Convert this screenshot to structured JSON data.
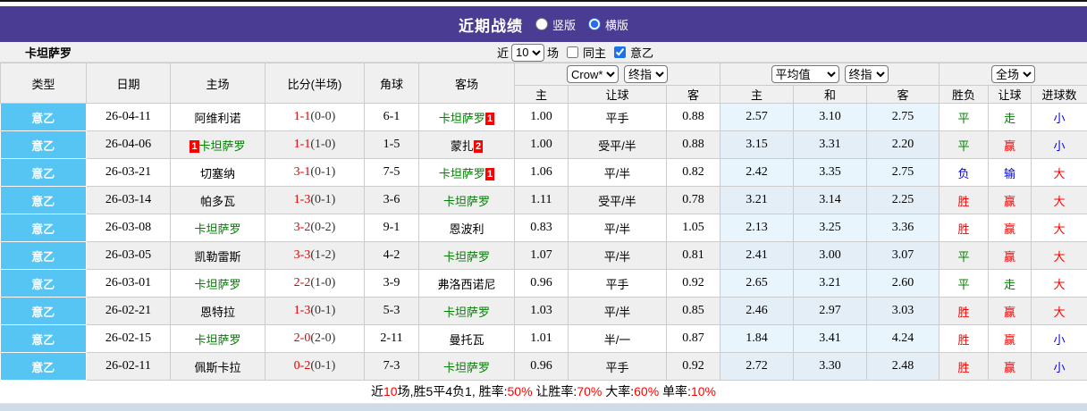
{
  "topbar": {
    "title": "近期战绩",
    "radios": [
      {
        "label": "竖版",
        "checked": false
      },
      {
        "label": "横版",
        "checked": true
      }
    ]
  },
  "controls": {
    "team": "卡坦萨罗",
    "near_label": "近",
    "match_count": "10",
    "field_label": "场",
    "same_home_label": "同主",
    "same_home_checked": false,
    "league_filter_label": "意乙",
    "league_filter_checked": true
  },
  "table": {
    "headers": {
      "type": "类型",
      "date": "日期",
      "home": "主场",
      "score": "比分(半场)",
      "corner": "角球",
      "away": "客场",
      "group1": {
        "select1": "Crow*",
        "select2": "终指",
        "cols": [
          "主",
          "让球",
          "客"
        ]
      },
      "group2": {
        "select1": "平均值",
        "select2": "终指",
        "cols": [
          "主",
          "和",
          "客"
        ]
      },
      "group3": {
        "select1": "全场",
        "cols": [
          "胜负",
          "让球",
          "进球数"
        ]
      }
    },
    "rows": [
      {
        "league": "意乙",
        "date": "26-04-11",
        "home": {
          "name": "阿维利诺",
          "green": false,
          "rank": ""
        },
        "ft": "1-1",
        "ht": "(0-0)",
        "corner": "6-1",
        "away": {
          "name": "卡坦萨罗",
          "green": true,
          "rank": "1"
        },
        "odds": [
          "1.00",
          "平手",
          "0.88"
        ],
        "avg": [
          "2.57",
          "3.10",
          "2.75"
        ],
        "results": [
          {
            "t": "平",
            "c": "green"
          },
          {
            "t": "走",
            "c": "green"
          },
          {
            "t": "小",
            "c": "blue"
          }
        ]
      },
      {
        "league": "意乙",
        "date": "26-04-06",
        "home": {
          "name": "卡坦萨罗",
          "green": true,
          "rank": "1"
        },
        "ft": "1-1",
        "ht": "(1-0)",
        "corner": "1-5",
        "away": {
          "name": "蒙扎",
          "green": false,
          "rank": "2"
        },
        "odds": [
          "1.00",
          "受平/半",
          "0.88"
        ],
        "avg": [
          "3.15",
          "3.31",
          "2.20"
        ],
        "results": [
          {
            "t": "平",
            "c": "green"
          },
          {
            "t": "赢",
            "c": "red"
          },
          {
            "t": "小",
            "c": "blue"
          }
        ]
      },
      {
        "league": "意乙",
        "date": "26-03-21",
        "home": {
          "name": "切塞纳",
          "green": false,
          "rank": ""
        },
        "ft": "3-1",
        "ht": "(0-1)",
        "corner": "7-5",
        "away": {
          "name": "卡坦萨罗",
          "green": true,
          "rank": "1"
        },
        "odds": [
          "1.06",
          "平/半",
          "0.82"
        ],
        "avg": [
          "2.42",
          "3.35",
          "2.75"
        ],
        "results": [
          {
            "t": "负",
            "c": "blue"
          },
          {
            "t": "输",
            "c": "blue"
          },
          {
            "t": "大",
            "c": "red"
          }
        ]
      },
      {
        "league": "意乙",
        "date": "26-03-14",
        "home": {
          "name": "帕多瓦",
          "green": false,
          "rank": ""
        },
        "ft": "1-3",
        "ht": "(0-1)",
        "corner": "3-6",
        "away": {
          "name": "卡坦萨罗",
          "green": true,
          "rank": ""
        },
        "odds": [
          "1.11",
          "受平/半",
          "0.78"
        ],
        "avg": [
          "3.21",
          "3.14",
          "2.25"
        ],
        "results": [
          {
            "t": "胜",
            "c": "red"
          },
          {
            "t": "赢",
            "c": "red"
          },
          {
            "t": "大",
            "c": "red"
          }
        ]
      },
      {
        "league": "意乙",
        "date": "26-03-08",
        "home": {
          "name": "卡坦萨罗",
          "green": true,
          "rank": ""
        },
        "ft": "3-2",
        "ht": "(0-2)",
        "corner": "9-1",
        "away": {
          "name": "恩波利",
          "green": false,
          "rank": ""
        },
        "odds": [
          "0.83",
          "平/半",
          "1.05"
        ],
        "avg": [
          "2.13",
          "3.25",
          "3.36"
        ],
        "results": [
          {
            "t": "胜",
            "c": "red"
          },
          {
            "t": "赢",
            "c": "red"
          },
          {
            "t": "大",
            "c": "red"
          }
        ]
      },
      {
        "league": "意乙",
        "date": "26-03-05",
        "home": {
          "name": "凯勒雷斯",
          "green": false,
          "rank": ""
        },
        "ft": "3-3",
        "ht": "(1-2)",
        "corner": "4-2",
        "away": {
          "name": "卡坦萨罗",
          "green": true,
          "rank": ""
        },
        "odds": [
          "1.07",
          "平/半",
          "0.81"
        ],
        "avg": [
          "2.41",
          "3.00",
          "3.07"
        ],
        "results": [
          {
            "t": "平",
            "c": "green"
          },
          {
            "t": "赢",
            "c": "red"
          },
          {
            "t": "大",
            "c": "red"
          }
        ]
      },
      {
        "league": "意乙",
        "date": "26-03-01",
        "home": {
          "name": "卡坦萨罗",
          "green": true,
          "rank": ""
        },
        "ft": "2-2",
        "ht": "(1-0)",
        "corner": "3-9",
        "away": {
          "name": "弗洛西诺尼",
          "green": false,
          "rank": ""
        },
        "odds": [
          "0.96",
          "平手",
          "0.92"
        ],
        "avg": [
          "2.65",
          "3.21",
          "2.60"
        ],
        "results": [
          {
            "t": "平",
            "c": "green"
          },
          {
            "t": "走",
            "c": "green"
          },
          {
            "t": "大",
            "c": "red"
          }
        ]
      },
      {
        "league": "意乙",
        "date": "26-02-21",
        "home": {
          "name": "恩特拉",
          "green": false,
          "rank": ""
        },
        "ft": "1-3",
        "ht": "(0-1)",
        "corner": "5-3",
        "away": {
          "name": "卡坦萨罗",
          "green": true,
          "rank": ""
        },
        "odds": [
          "1.03",
          "平/半",
          "0.85"
        ],
        "avg": [
          "2.46",
          "2.97",
          "3.03"
        ],
        "results": [
          {
            "t": "胜",
            "c": "red"
          },
          {
            "t": "赢",
            "c": "red"
          },
          {
            "t": "大",
            "c": "red"
          }
        ]
      },
      {
        "league": "意乙",
        "date": "26-02-15",
        "home": {
          "name": "卡坦萨罗",
          "green": true,
          "rank": ""
        },
        "ft": "2-0",
        "ht": "(2-0)",
        "corner": "2-11",
        "away": {
          "name": "曼托瓦",
          "green": false,
          "rank": ""
        },
        "odds": [
          "1.01",
          "半/一",
          "0.87"
        ],
        "avg": [
          "1.84",
          "3.41",
          "4.24"
        ],
        "results": [
          {
            "t": "胜",
            "c": "red"
          },
          {
            "t": "赢",
            "c": "red"
          },
          {
            "t": "小",
            "c": "blue"
          }
        ]
      },
      {
        "league": "意乙",
        "date": "26-02-11",
        "home": {
          "name": "佩斯卡拉",
          "green": false,
          "rank": ""
        },
        "ft": "0-2",
        "ht": "(0-1)",
        "corner": "7-3",
        "away": {
          "name": "卡坦萨罗",
          "green": true,
          "rank": ""
        },
        "odds": [
          "0.96",
          "平手",
          "0.92"
        ],
        "avg": [
          "2.72",
          "3.30",
          "2.48"
        ],
        "results": [
          {
            "t": "胜",
            "c": "red"
          },
          {
            "t": "赢",
            "c": "red"
          },
          {
            "t": "小",
            "c": "blue"
          }
        ]
      }
    ]
  },
  "footer": {
    "segments": [
      {
        "text": "近",
        "red": false
      },
      {
        "text": "10",
        "red": true
      },
      {
        "text": "场,胜5平4负1, 胜率:",
        "red": false
      },
      {
        "text": "50%",
        "red": true
      },
      {
        "text": " 让胜率:",
        "red": false
      },
      {
        "text": "70%",
        "red": true
      },
      {
        "text": " 大率:",
        "red": false
      },
      {
        "text": "60%",
        "red": true
      },
      {
        "text": " 单率:",
        "red": false
      },
      {
        "text": "10%",
        "red": true
      }
    ]
  },
  "colors": {
    "topbar_bg": "#4a3c92",
    "league_cell_bg": "#57c5f3",
    "team_highlight": "#008000",
    "win_red": "#ff0000",
    "lose_blue": "#0000ee",
    "avg_col_bg": "#e9f5fc",
    "alt_row_bg": "#efefef"
  }
}
